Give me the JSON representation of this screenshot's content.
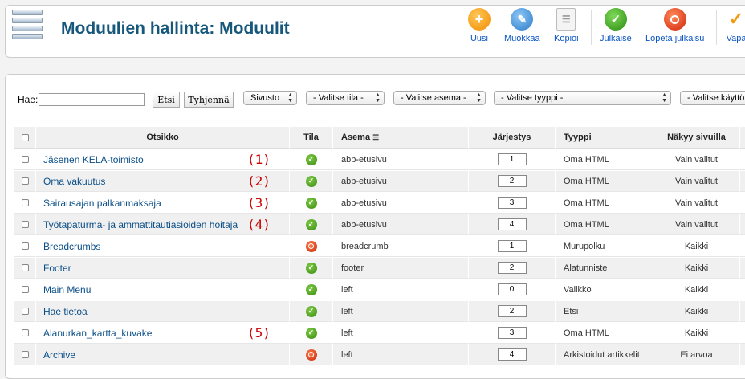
{
  "header": {
    "title": "Moduulien hallinta: Moduulit",
    "buttons": [
      {
        "label": "Uusi",
        "icon": "plus-icon",
        "color": "#f7a21b"
      },
      {
        "label": "Muokkaa",
        "icon": "pencil-icon",
        "color": "#3b8fd6"
      },
      {
        "label": "Kopioi",
        "icon": "copy-icon",
        "color": "#dddddd"
      },
      {
        "label": "Julkaise",
        "icon": "check-icon",
        "color": "#3c9a1e"
      },
      {
        "label": "Lopeta julkaisu",
        "icon": "stop-icon",
        "color": "#d9331a"
      },
      {
        "label": "Vapa",
        "icon": "checkmark-orange-icon",
        "color": "#f7a21b"
      }
    ]
  },
  "filters": {
    "search_label": "Hae:",
    "search_value": "",
    "go_label": "Etsi",
    "reset_label": "Tyhjennä",
    "selects": [
      {
        "label": "Sivusto"
      },
      {
        "label": "- Valitse tila -"
      },
      {
        "label": "- Valitse asema -"
      },
      {
        "label": "- Valitse tyyppi -"
      },
      {
        "label": "- Valitse käyttö"
      }
    ]
  },
  "table": {
    "columns": {
      "title": "Otsikko",
      "status": "Tila",
      "position": "Asema",
      "order": "Järjestys",
      "type": "Tyyppi",
      "visibility": "Näkyy sivuilla"
    },
    "rows": [
      {
        "title": "Jäsenen KELA-toimisto",
        "marker": "(1)",
        "published": true,
        "position": "abb-etusivu",
        "order": "1",
        "type": "Oma HTML",
        "visibility": "Vain valitut"
      },
      {
        "title": "Oma vakuutus",
        "marker": "(2)",
        "published": true,
        "position": "abb-etusivu",
        "order": "2",
        "type": "Oma HTML",
        "visibility": "Vain valitut"
      },
      {
        "title": "Sairausajan palkanmaksaja",
        "marker": "(3)",
        "published": true,
        "position": "abb-etusivu",
        "order": "3",
        "type": "Oma HTML",
        "visibility": "Vain valitut"
      },
      {
        "title": "Työtapaturma- ja ammattitautiasioiden hoitaja",
        "marker": "(4)",
        "published": true,
        "position": "abb-etusivu",
        "order": "4",
        "type": "Oma HTML",
        "visibility": "Vain valitut"
      },
      {
        "title": "Breadcrumbs",
        "marker": "",
        "published": false,
        "position": "breadcrumb",
        "order": "1",
        "type": "Murupolku",
        "visibility": "Kaikki"
      },
      {
        "title": "Footer",
        "marker": "",
        "published": true,
        "position": "footer",
        "order": "2",
        "type": "Alatunniste",
        "visibility": "Kaikki"
      },
      {
        "title": "Main Menu",
        "marker": "",
        "published": true,
        "position": "left",
        "order": "0",
        "type": "Valikko",
        "visibility": "Kaikki"
      },
      {
        "title": "Hae tietoa",
        "marker": "",
        "published": true,
        "position": "left",
        "order": "2",
        "type": "Etsi",
        "visibility": "Kaikki"
      },
      {
        "title": "Alanurkan_kartta_kuvake",
        "marker": "(5)",
        "published": true,
        "position": "left",
        "order": "3",
        "type": "Oma HTML",
        "visibility": "Kaikki"
      },
      {
        "title": "Archive",
        "marker": "",
        "published": false,
        "position": "left",
        "order": "4",
        "type": "Arkistoidut artikkelit",
        "visibility": "Ei arvoa"
      }
    ]
  }
}
